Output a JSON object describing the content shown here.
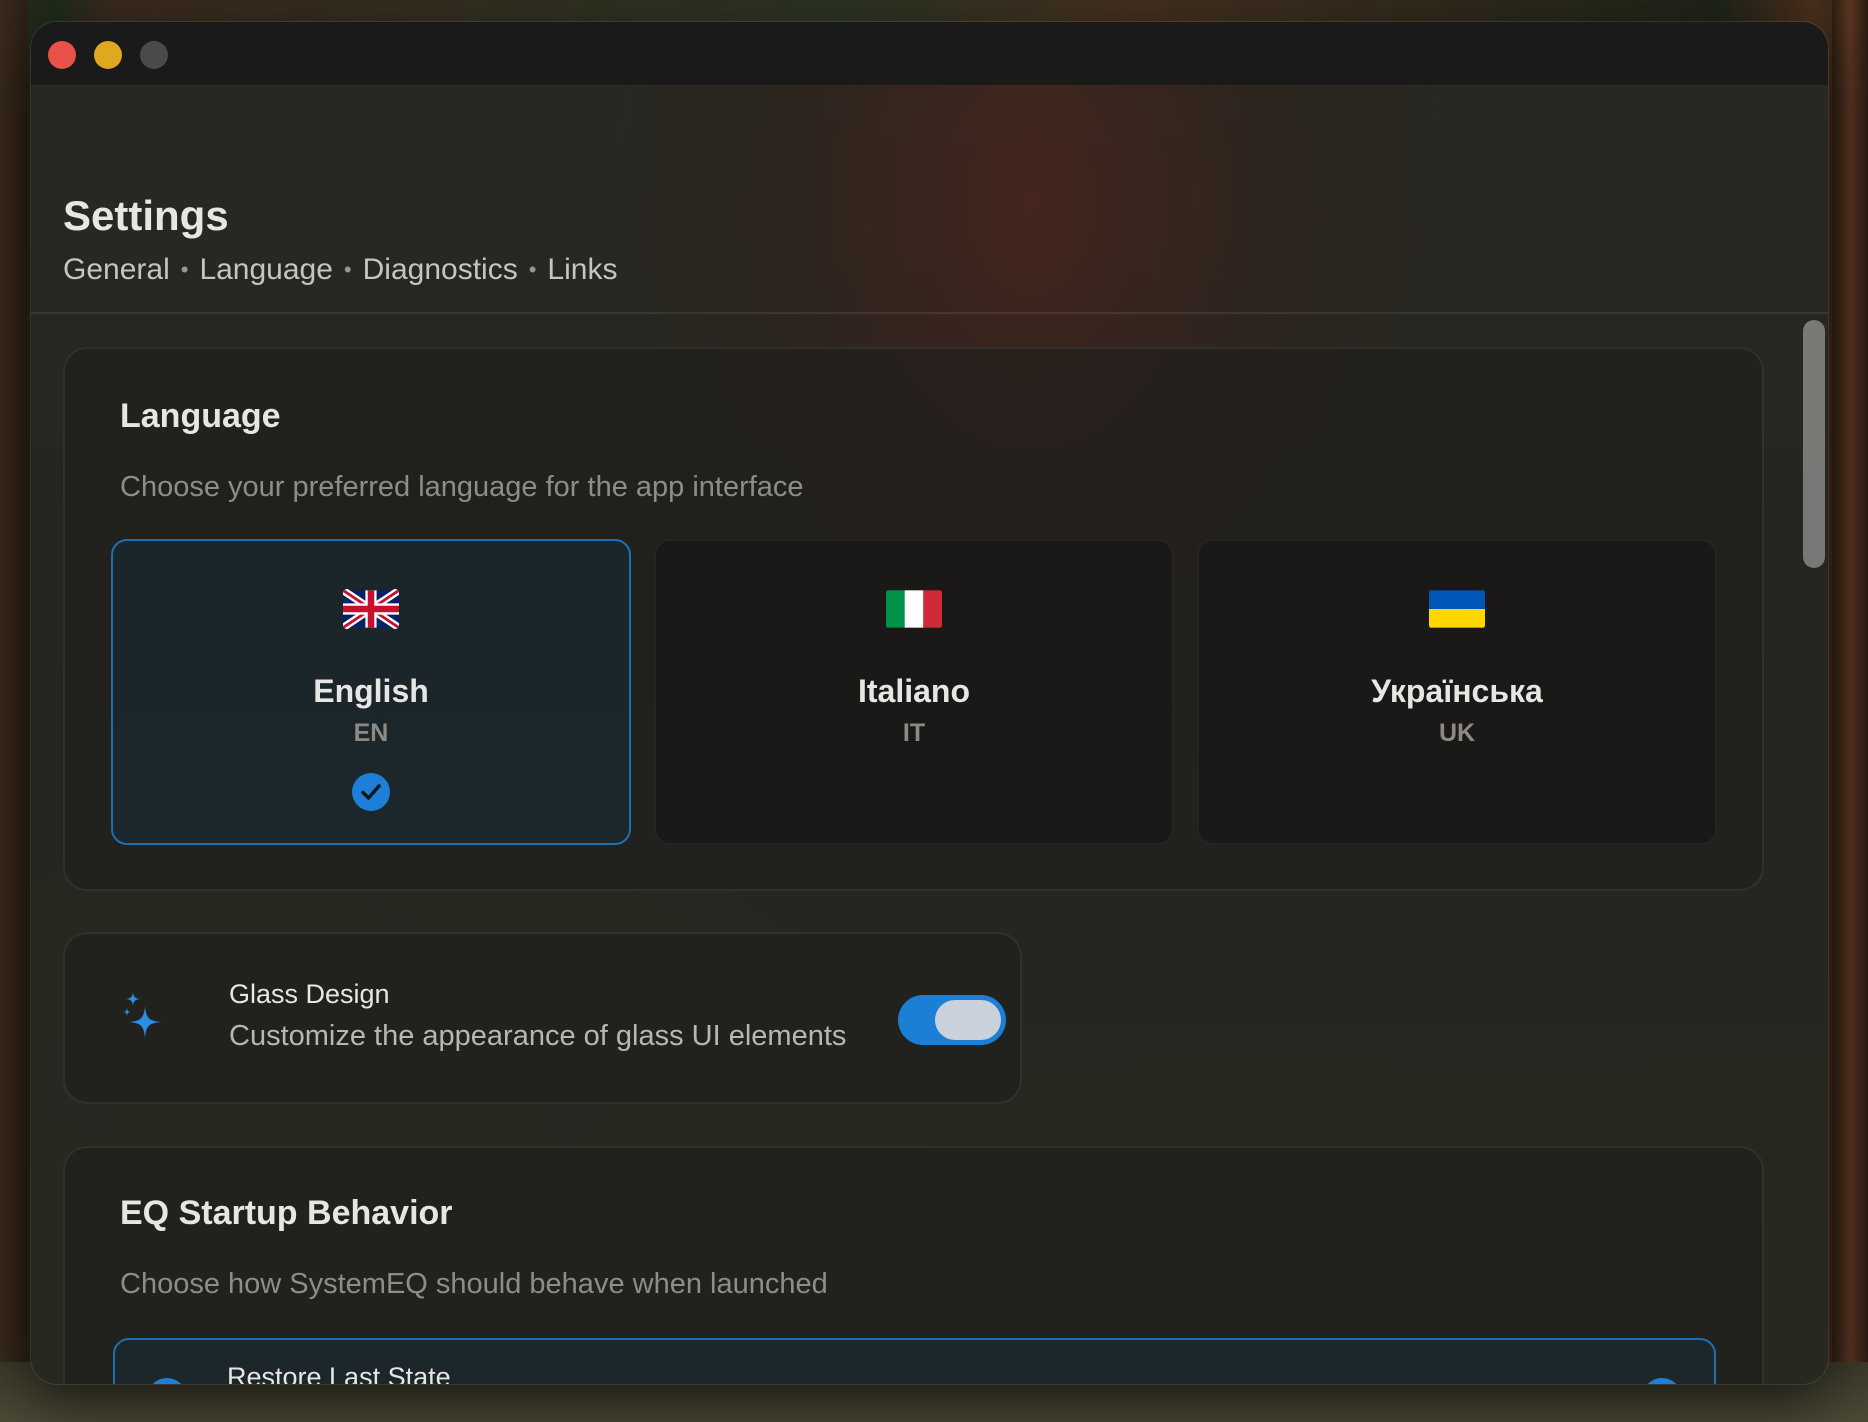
{
  "window": {
    "controls": {
      "close_icon": "close-icon",
      "minimize_icon": "minimize-icon",
      "zoom_icon": "zoom-icon"
    }
  },
  "header": {
    "title": "Settings",
    "breadcrumb": [
      "General",
      "Language",
      "Diagnostics",
      "Links"
    ],
    "separator": "•"
  },
  "language_section": {
    "title": "Language",
    "subtitle": "Choose your preferred language for the app interface",
    "options": [
      {
        "name": "English",
        "code": "EN",
        "flag": "uk-flag-icon",
        "selected": true
      },
      {
        "name": "Italiano",
        "code": "IT",
        "flag": "italy-flag-icon",
        "selected": false
      },
      {
        "name": "Українська",
        "code": "UK",
        "flag": "ukraine-flag-icon",
        "selected": false
      }
    ],
    "accent_color": "#1d7fd8"
  },
  "glass_design": {
    "icon": "sparkles-icon",
    "title": "Glass Design",
    "subtitle": "Customize the appearance of glass UI elements",
    "enabled": true
  },
  "eq_startup": {
    "title": "EQ Startup Behavior",
    "subtitle": "Choose how SystemEQ should behave when launched",
    "options": [
      {
        "title": "Restore Last State",
        "selected": true
      }
    ]
  }
}
